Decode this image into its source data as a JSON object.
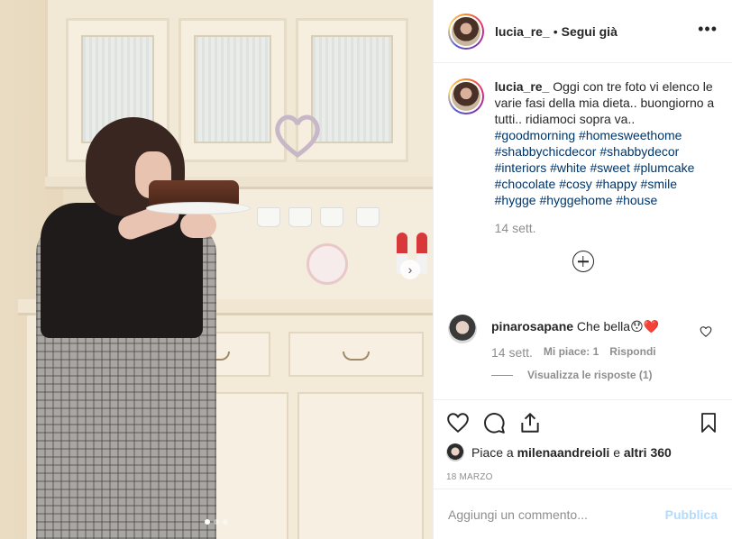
{
  "post": {
    "username": "lucia_re_",
    "separator": "•",
    "follow_label": "Segui già",
    "more_icon": "more-horizontal-icon"
  },
  "caption": {
    "username": "lucia_re_",
    "text": "Oggi con tre foto vi elenco le varie fasi della mia dieta.. buongiorno a tutti.. ridiamoci sopra va..",
    "hashtags": [
      "#goodmorning",
      "#homesweethome",
      "#shabbychicdecor",
      "#shabbydecor",
      "#interiors",
      "#white",
      "#sweet",
      "#plumcake",
      "#chocolate",
      "#cosy",
      "#happy",
      "#smile",
      "#hygge",
      "#hyggehome",
      "#house"
    ],
    "time": "14 sett."
  },
  "comment": {
    "username": "pinarosapane",
    "text": "Che bella😯❤️",
    "time": "14 sett.",
    "likes": "Mi piace: 1",
    "reply": "Rispondi",
    "view_replies": "Visualizza le risposte (1)"
  },
  "likes": {
    "prefix": "Piace a",
    "user": "milenaandreioli",
    "middle": "e",
    "others": "altri 360"
  },
  "date": "18 MARZO",
  "add_comment": {
    "placeholder": "Aggiungi un commento...",
    "publish": "Pubblica"
  },
  "carousel": {
    "count": 3,
    "active": 0
  },
  "colors": {
    "link": "#003569",
    "muted": "#8e8e8e",
    "publish_disabled": "#b3dbff",
    "heart": "#ed4956"
  }
}
